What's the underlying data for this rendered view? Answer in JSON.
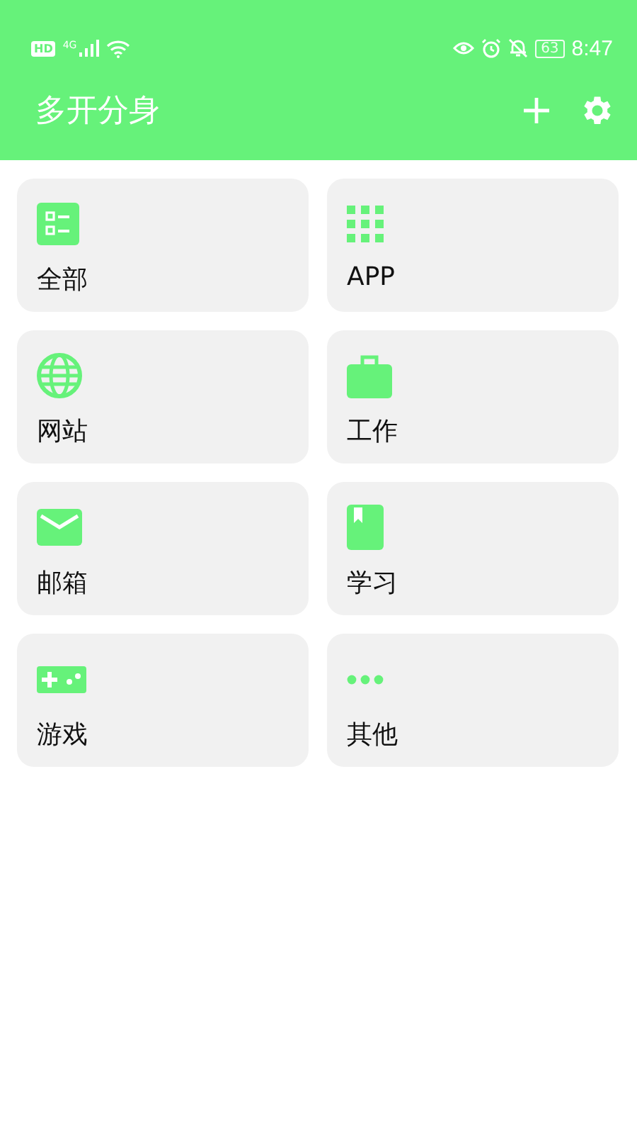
{
  "status_bar": {
    "hd": "HD",
    "network": "4G",
    "battery": "63",
    "time": "8:47"
  },
  "app_bar": {
    "title": "多开分身"
  },
  "categories": [
    {
      "kind": "list",
      "label": "全部"
    },
    {
      "kind": "grid",
      "label": "APP"
    },
    {
      "kind": "globe",
      "label": "网站"
    },
    {
      "kind": "briefcase",
      "label": "工作"
    },
    {
      "kind": "mail",
      "label": "邮箱"
    },
    {
      "kind": "book",
      "label": "学习"
    },
    {
      "kind": "gamepad",
      "label": "游戏"
    },
    {
      "kind": "dots",
      "label": "其他"
    }
  ]
}
